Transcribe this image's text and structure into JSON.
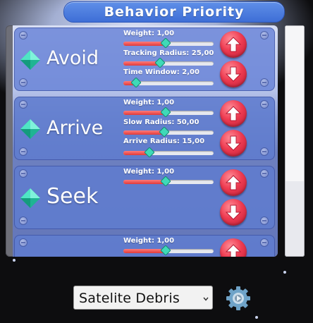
{
  "title": "Behavior Priority",
  "colors": {
    "title_bar": "#4a7be0",
    "card": "#607cce",
    "slider_fill": "#e03a3a",
    "slider_knob": "#3fd9b8",
    "arrow_button": "#ef3c52",
    "gem": "#2fd3b0"
  },
  "behaviors": [
    {
      "name": "Avoid",
      "icon": "diamond-gem-icon",
      "params": [
        {
          "label": "Weight: 1,00",
          "fraction": 0.47
        },
        {
          "label": "Tracking Radius: 25,00",
          "fraction": 0.41
        },
        {
          "label": "Time Window: 2,00",
          "fraction": 0.14
        }
      ]
    },
    {
      "name": "Arrive",
      "icon": "diamond-gem-icon",
      "params": [
        {
          "label": "Weight: 1,00",
          "fraction": 0.47
        },
        {
          "label": "Slow Radius: 50,00",
          "fraction": 0.45
        },
        {
          "label": "Arrive Radius: 15,00",
          "fraction": 0.29
        }
      ]
    },
    {
      "name": "Seek",
      "icon": "diamond-gem-icon",
      "params": [
        {
          "label": "Weight: 1,00",
          "fraction": 0.47
        }
      ]
    },
    {
      "name": "",
      "icon": "diamond-gem-icon",
      "params": [
        {
          "label": "Weight: 1,00",
          "fraction": 0.47
        }
      ]
    }
  ],
  "move_up_icon": "arrow-up-icon",
  "move_down_icon": "arrow-down-icon",
  "dropdown": {
    "selected": "Satelite Debris",
    "caret_icon": "chevron-down-icon"
  },
  "settings_icon": "gear-icon"
}
